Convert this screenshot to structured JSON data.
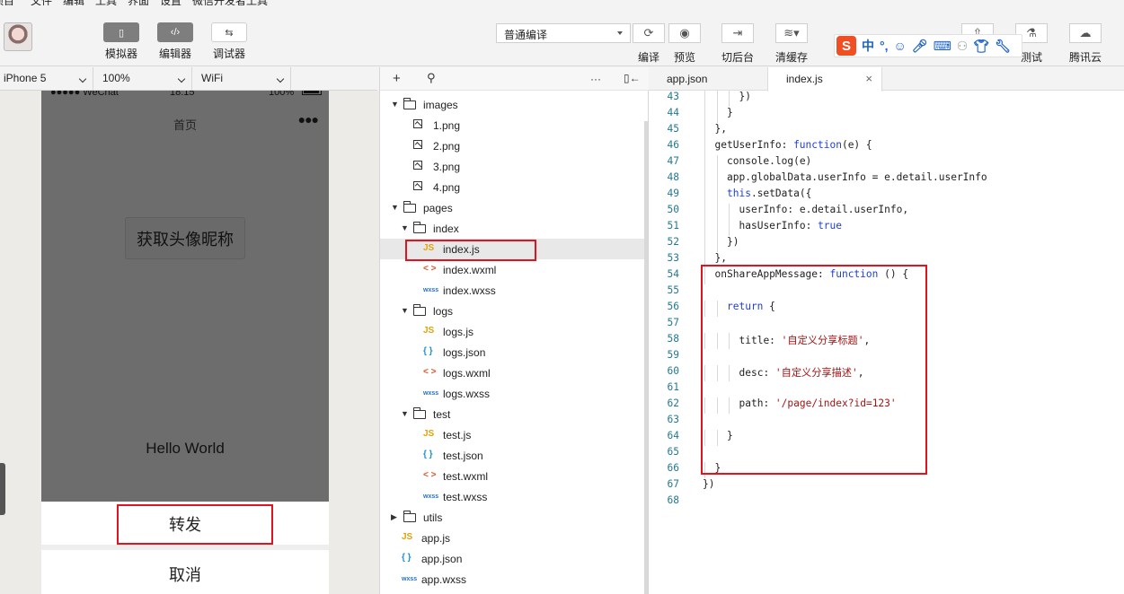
{
  "menubar": [
    "项目",
    "文件",
    "编辑",
    "工具",
    "界面",
    "设置",
    "微信开发者工具"
  ],
  "toolbar": {
    "simulator_label": "模拟器",
    "editor_label": "编辑器",
    "debugger_label": "调试器",
    "compile_mode": "普通编译",
    "compile_label": "编译",
    "preview_label": "预览",
    "background_label": "切后台",
    "clear_cache_label": "清缓存",
    "test_label": "测试",
    "tencent_cloud_label": "腾讯云"
  },
  "ime": {
    "logo": "S",
    "mode": "中",
    "punct": "°,"
  },
  "device_bar": {
    "device": "iPhone 5",
    "zoom": "100%",
    "network": "WiFi"
  },
  "phone": {
    "carrier": "●●●●● WeChat",
    "time": "18:15",
    "battery": "100%",
    "nav_title": "首页",
    "nav_menu": "●●●",
    "get_avatar_button": "获取头像昵称",
    "hello_text": "Hello World",
    "share_option": "转发",
    "cancel_option": "取消"
  },
  "explorer": {
    "tree": [
      {
        "name": "images",
        "type": "folder",
        "expanded": true,
        "depth": 0
      },
      {
        "name": "1.png",
        "type": "png",
        "depth": 1
      },
      {
        "name": "2.png",
        "type": "png",
        "depth": 1
      },
      {
        "name": "3.png",
        "type": "png",
        "depth": 1
      },
      {
        "name": "4.png",
        "type": "png",
        "depth": 1
      },
      {
        "name": "pages",
        "type": "folder",
        "expanded": true,
        "depth": 0
      },
      {
        "name": "index",
        "type": "folder",
        "expanded": true,
        "depth": 1
      },
      {
        "name": "index.js",
        "type": "js",
        "depth": 2,
        "selected": true
      },
      {
        "name": "index.wxml",
        "type": "wxml",
        "depth": 2
      },
      {
        "name": "index.wxss",
        "type": "wxss",
        "depth": 2
      },
      {
        "name": "logs",
        "type": "folder",
        "expanded": true,
        "depth": 1
      },
      {
        "name": "logs.js",
        "type": "js",
        "depth": 2
      },
      {
        "name": "logs.json",
        "type": "json",
        "depth": 2
      },
      {
        "name": "logs.wxml",
        "type": "wxml",
        "depth": 2
      },
      {
        "name": "logs.wxss",
        "type": "wxss",
        "depth": 2
      },
      {
        "name": "test",
        "type": "folder",
        "expanded": true,
        "depth": 1
      },
      {
        "name": "test.js",
        "type": "js",
        "depth": 2
      },
      {
        "name": "test.json",
        "type": "json",
        "depth": 2
      },
      {
        "name": "test.wxml",
        "type": "wxml",
        "depth": 2
      },
      {
        "name": "test.wxss",
        "type": "wxss",
        "depth": 2
      },
      {
        "name": "utils",
        "type": "folder",
        "expanded": false,
        "depth": 0
      },
      {
        "name": "app.js",
        "type": "js",
        "depth": 0
      },
      {
        "name": "app.json",
        "type": "json",
        "depth": 0
      },
      {
        "name": "app.wxss",
        "type": "wxss",
        "depth": 0
      }
    ],
    "icon_labels": {
      "js": "JS",
      "json": "{ }",
      "wxml": "< >",
      "wxss": "wxss"
    }
  },
  "editor": {
    "tabs": [
      {
        "label": "app.json",
        "active": false
      },
      {
        "label": "index.js",
        "active": true
      }
    ],
    "close_glyph": "×",
    "lines": [
      {
        "n": "43",
        "indent": 3,
        "parts": [
          [
            "t",
            "})"
          ]
        ]
      },
      {
        "n": "44",
        "indent": 2,
        "parts": [
          [
            "t",
            "}"
          ]
        ]
      },
      {
        "n": "45",
        "indent": 1,
        "parts": [
          [
            "t",
            "},"
          ]
        ]
      },
      {
        "n": "46",
        "indent": 1,
        "parts": [
          [
            "t",
            "getUserInfo: "
          ],
          [
            "k",
            "function"
          ],
          [
            "t",
            "(e) {"
          ]
        ]
      },
      {
        "n": "47",
        "indent": 2,
        "parts": [
          [
            "t",
            "console.log(e)"
          ]
        ]
      },
      {
        "n": "48",
        "indent": 2,
        "parts": [
          [
            "t",
            "app.globalData.userInfo = e.detail.userInfo"
          ]
        ]
      },
      {
        "n": "49",
        "indent": 2,
        "parts": [
          [
            "k",
            "this"
          ],
          [
            "t",
            ".setData({"
          ]
        ]
      },
      {
        "n": "50",
        "indent": 3,
        "parts": [
          [
            "t",
            "userInfo: e.detail.userInfo,"
          ]
        ]
      },
      {
        "n": "51",
        "indent": 3,
        "parts": [
          [
            "t",
            "hasUserInfo: "
          ],
          [
            "k",
            "true"
          ]
        ]
      },
      {
        "n": "52",
        "indent": 2,
        "parts": [
          [
            "t",
            "})"
          ]
        ]
      },
      {
        "n": "53",
        "indent": 1,
        "parts": [
          [
            "t",
            "},"
          ]
        ]
      },
      {
        "n": "54",
        "indent": 1,
        "parts": [
          [
            "t",
            "onShareAppMessage: "
          ],
          [
            "k",
            "function"
          ],
          [
            "t",
            " () {"
          ]
        ]
      },
      {
        "n": "55",
        "indent": 0,
        "parts": []
      },
      {
        "n": "56",
        "indent": 2,
        "parts": [
          [
            "k",
            "return"
          ],
          [
            "t",
            " {"
          ]
        ]
      },
      {
        "n": "57",
        "indent": 0,
        "parts": []
      },
      {
        "n": "58",
        "indent": 3,
        "parts": [
          [
            "t",
            "title: "
          ],
          [
            "s",
            "'自定义分享标题'"
          ],
          [
            "t",
            ","
          ]
        ]
      },
      {
        "n": "59",
        "indent": 0,
        "parts": []
      },
      {
        "n": "60",
        "indent": 3,
        "parts": [
          [
            "t",
            "desc: "
          ],
          [
            "s",
            "'自定义分享描述'"
          ],
          [
            "t",
            ","
          ]
        ]
      },
      {
        "n": "61",
        "indent": 0,
        "parts": []
      },
      {
        "n": "62",
        "indent": 3,
        "parts": [
          [
            "t",
            "path: "
          ],
          [
            "s",
            "'/page/index?id=123'"
          ]
        ]
      },
      {
        "n": "63",
        "indent": 0,
        "parts": []
      },
      {
        "n": "64",
        "indent": 2,
        "parts": [
          [
            "t",
            "}"
          ]
        ]
      },
      {
        "n": "65",
        "indent": 0,
        "parts": []
      },
      {
        "n": "66",
        "indent": 1,
        "parts": [
          [
            "t",
            "}"
          ]
        ]
      },
      {
        "n": "67",
        "indent": 0,
        "parts": [
          [
            "t",
            "})"
          ]
        ]
      },
      {
        "n": "68",
        "indent": 0,
        "parts": []
      }
    ]
  },
  "colors": {
    "highlight_red": "#e0141e",
    "keyword": "#1f3fd6",
    "string": "#a31515",
    "line_number": "#237893"
  }
}
